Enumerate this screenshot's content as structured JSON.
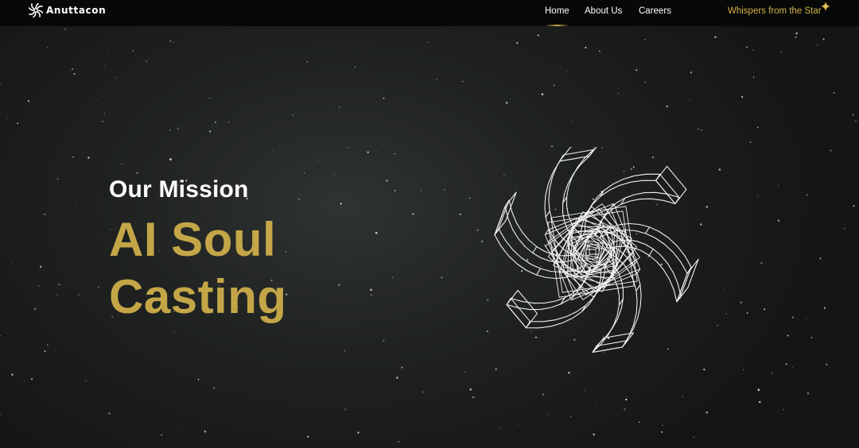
{
  "brand": {
    "logo_icon": "spiral-flower-logo-icon",
    "name": "Anuttacon"
  },
  "nav": {
    "items": [
      {
        "label": "Home",
        "active": true
      },
      {
        "label": "About Us",
        "active": false
      },
      {
        "label": "Careers",
        "active": false
      }
    ],
    "highlight_link": "Whispers from the Star",
    "highlight_icon": "sparkle-icon"
  },
  "hero": {
    "eyebrow": "Our Mission",
    "title_line1": "AI Soul",
    "title_line2": "Casting",
    "illustration": "wireframe-pinwheel-icon"
  },
  "colors": {
    "background": "#1f2221",
    "navbar": "#070808",
    "accent_gold": "#c4a648",
    "text": "#ffffff"
  }
}
